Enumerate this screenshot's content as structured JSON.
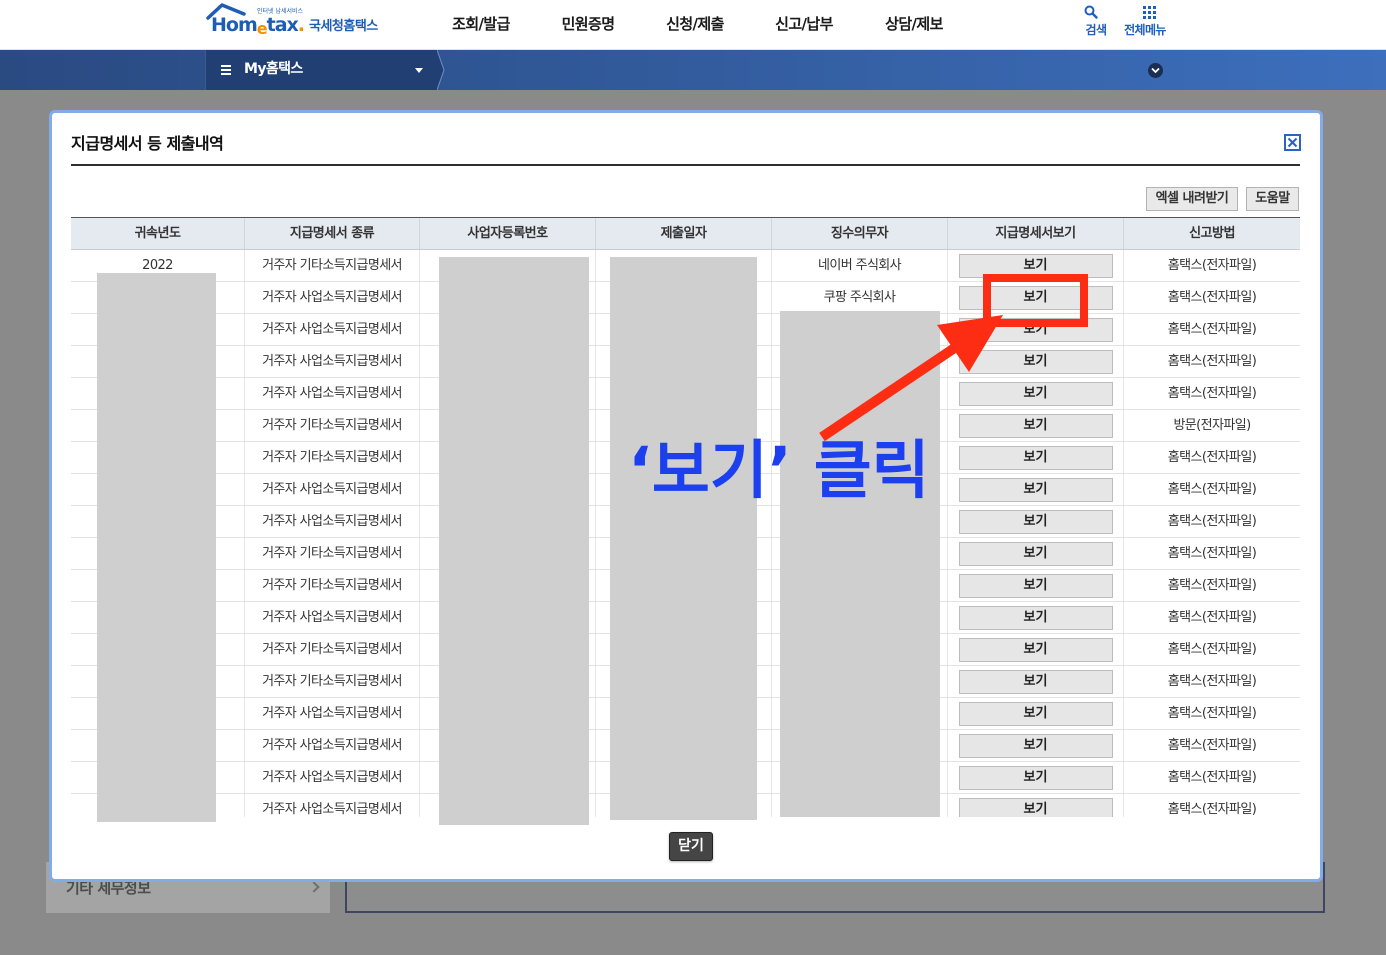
{
  "header": {
    "logo": {
      "parts": [
        "Hom",
        "e",
        "tax",
        "."
      ],
      "tagline": "인터넷 납세서비스",
      "name": "국세청홈택스"
    },
    "nav": [
      "조회/발급",
      "민원증명",
      "신청/제출",
      "신고/납부",
      "상담/제보"
    ],
    "search_label": "검색",
    "menu_label": "전체메뉴"
  },
  "subbar": {
    "my_menu_label": "My홈택스"
  },
  "modal": {
    "title": "지급명세서 등 제출내역",
    "excel_button": "엑셀 내려받기",
    "help_button": "도움말",
    "close_button": "닫기",
    "columns": [
      "귀속년도",
      "지급명세서 종류",
      "사업자등록번호",
      "제출일자",
      "징수의무자",
      "지급명세서보기",
      "신고방법"
    ],
    "rows": [
      {
        "year": "2022",
        "type": "거주자 기타소득지급명세서",
        "payer": "네이버 주식회사",
        "view": "보기",
        "method": "홈택스(전자파일)"
      },
      {
        "type": "거주자 사업소득지급명세서",
        "payer": "쿠팡 주식회사",
        "view": "보기",
        "method": "홈택스(전자파일)"
      },
      {
        "type": "거주자 사업소득지급명세서",
        "view": "보기",
        "method": "홈택스(전자파일)"
      },
      {
        "type": "거주자 사업소득지급명세서",
        "view": "보기",
        "method": "홈택스(전자파일)"
      },
      {
        "type": "거주자 사업소득지급명세서",
        "view": "보기",
        "method": "홈택스(전자파일)"
      },
      {
        "type": "거주자 기타소득지급명세서",
        "view": "보기",
        "method": "방문(전자파일)"
      },
      {
        "type": "거주자 기타소득지급명세서",
        "view": "보기",
        "method": "홈택스(전자파일)"
      },
      {
        "type": "거주자 사업소득지급명세서",
        "view": "보기",
        "method": "홈택스(전자파일)"
      },
      {
        "type": "거주자 사업소득지급명세서",
        "view": "보기",
        "method": "홈택스(전자파일)"
      },
      {
        "type": "거주자 기타소득지급명세서",
        "view": "보기",
        "method": "홈택스(전자파일)"
      },
      {
        "type": "거주자 기타소득지급명세서",
        "view": "보기",
        "method": "홈택스(전자파일)"
      },
      {
        "type": "거주자 사업소득지급명세서",
        "view": "보기",
        "method": "홈택스(전자파일)"
      },
      {
        "type": "거주자 기타소득지급명세서",
        "view": "보기",
        "method": "홈택스(전자파일)"
      },
      {
        "type": "거주자 기타소득지급명세서",
        "view": "보기",
        "method": "홈택스(전자파일)"
      },
      {
        "type": "거주자 사업소득지급명세서",
        "view": "보기",
        "method": "홈택스(전자파일)"
      },
      {
        "type": "거주자 사업소득지급명세서",
        "view": "보기",
        "method": "홈택스(전자파일)"
      },
      {
        "type": "거주자 사업소득지급명세서",
        "view": "보기",
        "method": "홈택스(전자파일)"
      },
      {
        "type": "거주자 사업소득지급명세서",
        "view": "보기",
        "method": "홈택스(전자파일)"
      }
    ]
  },
  "background_page": {
    "side_menu_item": "기타 세무정보"
  },
  "annotation": {
    "caption": "‘보기’ 클릭"
  },
  "icons": {
    "search": "search-icon",
    "all_menu": "grid-icon",
    "my_menu": "hamburger-icon",
    "my_menu_toggle": "dropdown-caret-icon",
    "subbar_toggle": "chevron-down-icon",
    "modal_close": "close-icon",
    "side_menu_arrow": "chevron-right-icon"
  },
  "colors": {
    "brand_blue": "#1d5db5",
    "overlay_gray": "#8a8a8a",
    "annotation_red": "#fc2d13",
    "annotation_blue": "#1c3ff0",
    "redaction_gray": "#cfcfcf",
    "close_button": "#454545"
  }
}
